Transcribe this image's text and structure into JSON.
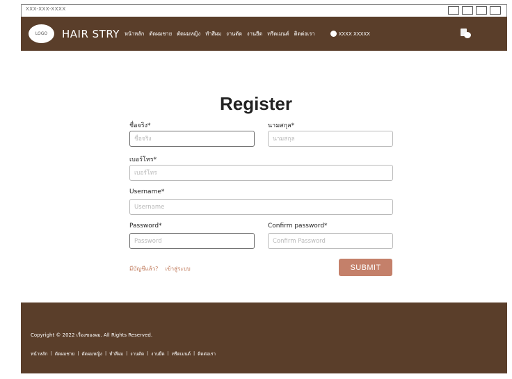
{
  "window": {
    "url": "XXX-XXX-XXXX"
  },
  "header": {
    "logo_text": "LOGO",
    "brand": "HAIR STRY",
    "nav": [
      "หน้าหลัก",
      "ตัดผมชาย",
      "ตัดผมหญิง",
      "ทำสีผม",
      "งานตัด",
      "งานยืด",
      "ทรีตเมนต์",
      "ติดต่อเรา"
    ],
    "user_name": "XXXX XXXXX"
  },
  "form": {
    "title": "Register",
    "first_name_label": "ชื่อจริง*",
    "first_name_placeholder": "ชื่อจริง",
    "last_name_label": "นามสกุล*",
    "last_name_placeholder": "นามสกุล",
    "phone_label": "เบอร์โทร*",
    "phone_placeholder": "เบอร์โทร",
    "username_label": "Username*",
    "username_placeholder": "Username",
    "password_label": "Password*",
    "password_placeholder": "Password",
    "confirm_label": "Confirm password*",
    "confirm_placeholder": "Confirm Password",
    "have_account_text": "มีบัญชีแล้ว?",
    "login_link": "เข้าสู่ระบบ",
    "submit_label": "SUBMIT"
  },
  "footer": {
    "copyright": "Copyright © 2022 เรื่องของผม. All Rights Reserved.",
    "nav": [
      "หน้าหลัก",
      "ตัดผมชาย",
      "ตัดผมหญิง",
      "ทำสีผม",
      "งานตัด",
      "งานยืด",
      "ทรีตเมนต์",
      "ติดต่อเรา"
    ]
  },
  "colors": {
    "brand_brown": "#5a3e2a",
    "accent": "#c4806a",
    "link": "#c07a5b"
  }
}
